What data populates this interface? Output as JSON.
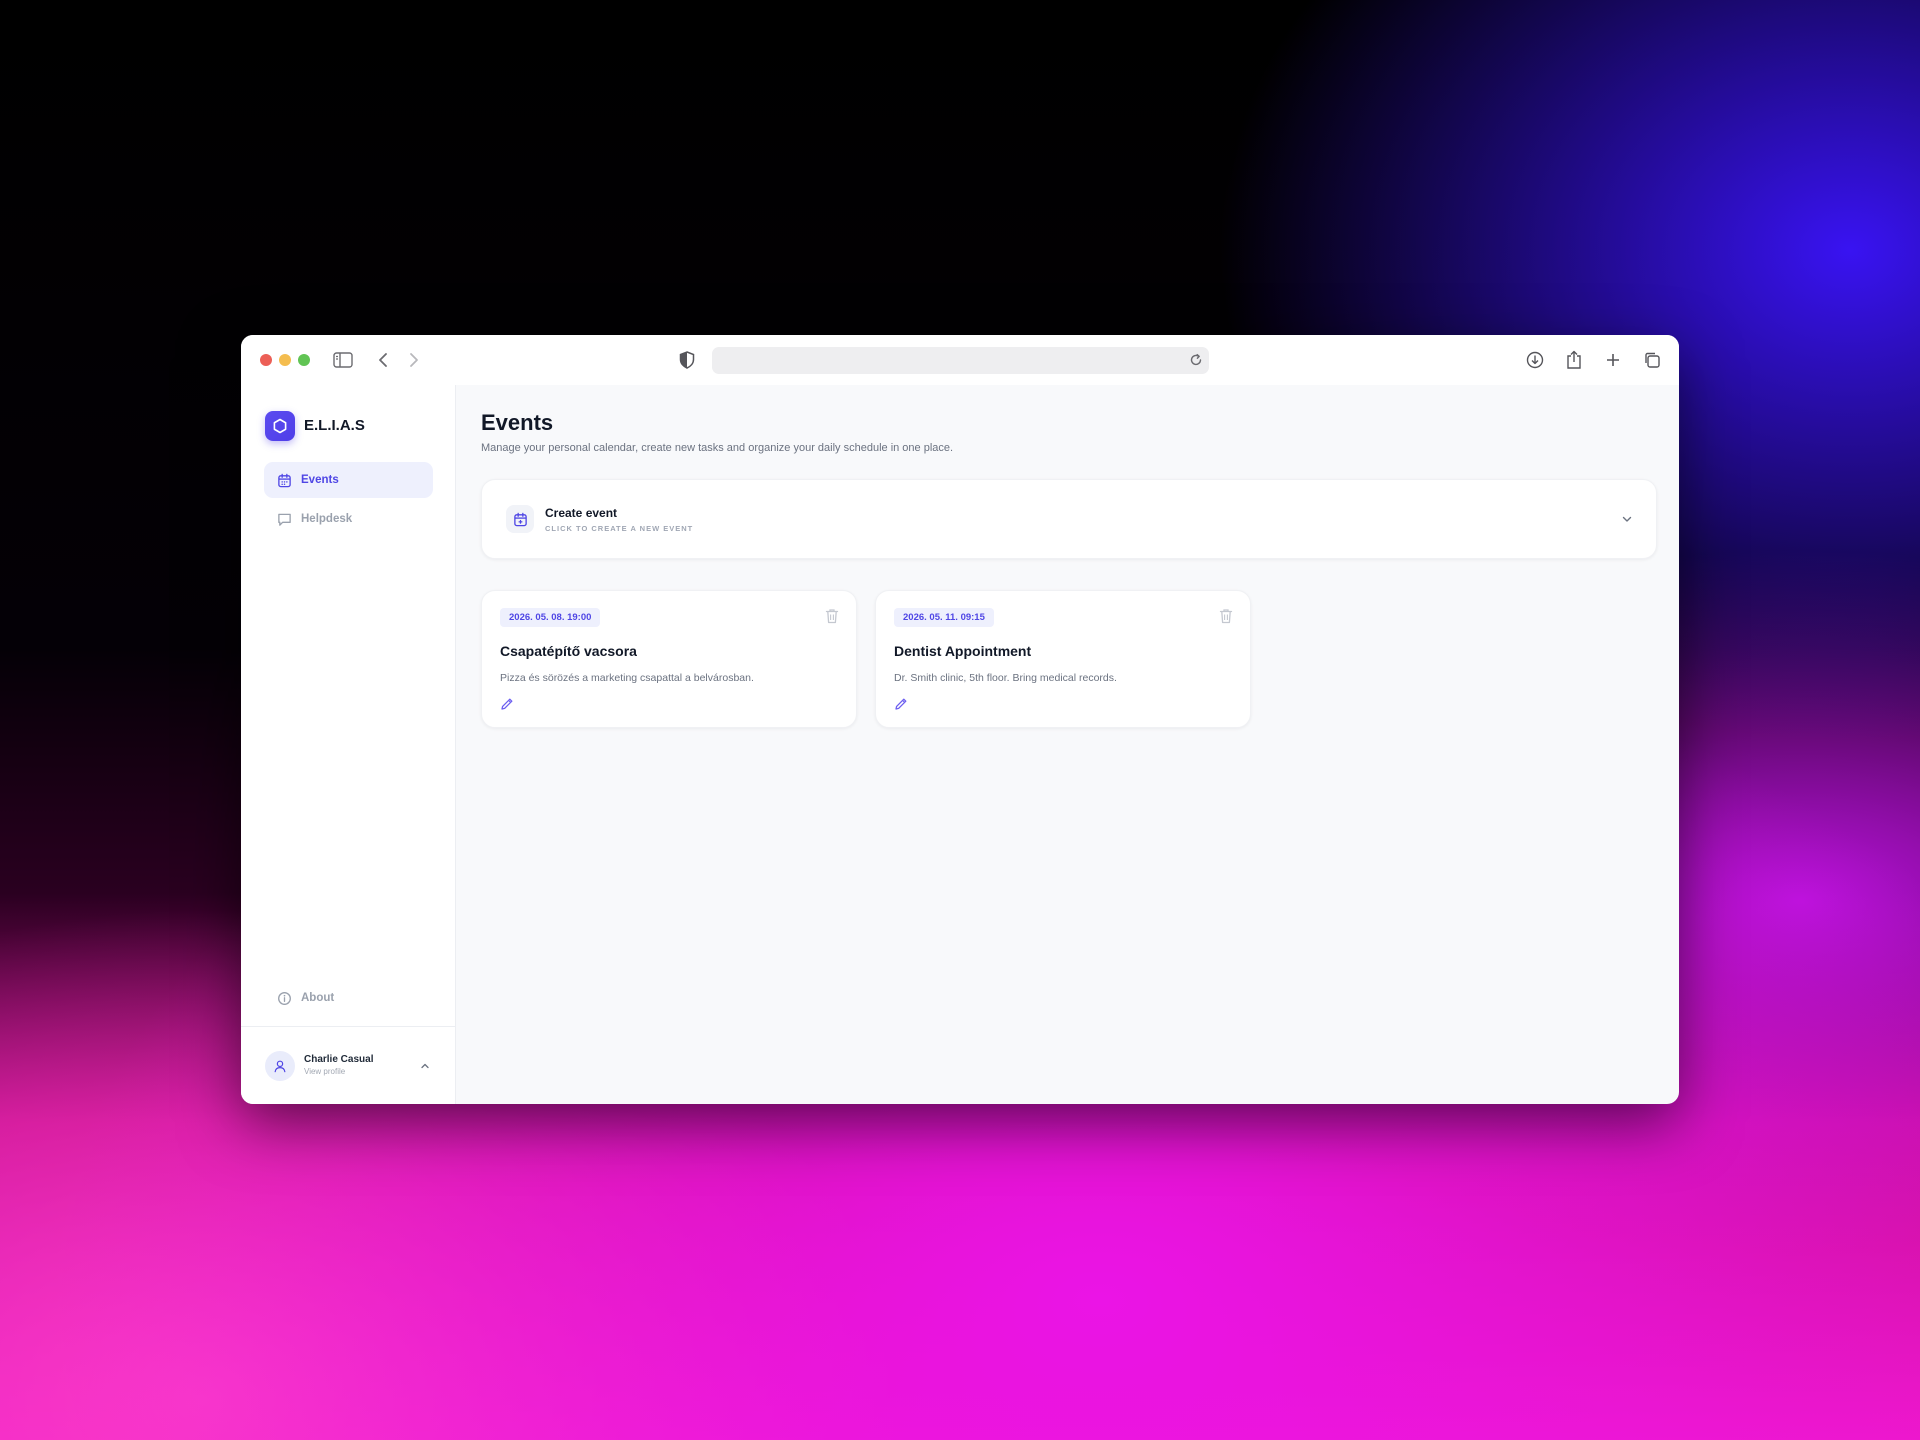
{
  "app": {
    "name": "E.L.I.A.S"
  },
  "browser": {
    "address": "",
    "icons": [
      "sidebar-toggle-icon",
      "back-icon",
      "forward-icon",
      "shield-icon",
      "reload-icon",
      "download-icon",
      "share-icon",
      "new-tab-icon",
      "tabs-overview-icon"
    ]
  },
  "sidebar": {
    "items": [
      {
        "label": "Events",
        "icon": "calendar-icon",
        "active": true
      },
      {
        "label": "Helpdesk",
        "icon": "chat-icon",
        "active": false
      }
    ],
    "about": {
      "label": "About",
      "icon": "info-icon"
    },
    "user": {
      "name": "Charlie Casual",
      "subtitle": "View profile"
    }
  },
  "main": {
    "title": "Events",
    "subtitle": "Manage your personal calendar, create new tasks and organize your daily schedule in one place.",
    "create": {
      "title": "Create event",
      "subtitle": "CLICK TO CREATE A NEW EVENT"
    },
    "events": [
      {
        "date": "2026. 05. 08. 19:00",
        "title": "Csapatépítő vacsora",
        "description": "Pizza és sörözés a marketing csapattal a belvárosban."
      },
      {
        "date": "2026. 05. 11. 09:15",
        "title": "Dentist Appointment",
        "description": "Dr. Smith clinic, 5th floor. Bring medical records."
      }
    ]
  },
  "colors": {
    "accent": "#4f46e5",
    "accent_light": "#eef0fd",
    "text_primary": "#111827",
    "text_muted": "#6b7280",
    "window_bg": "#f8f9fb"
  }
}
